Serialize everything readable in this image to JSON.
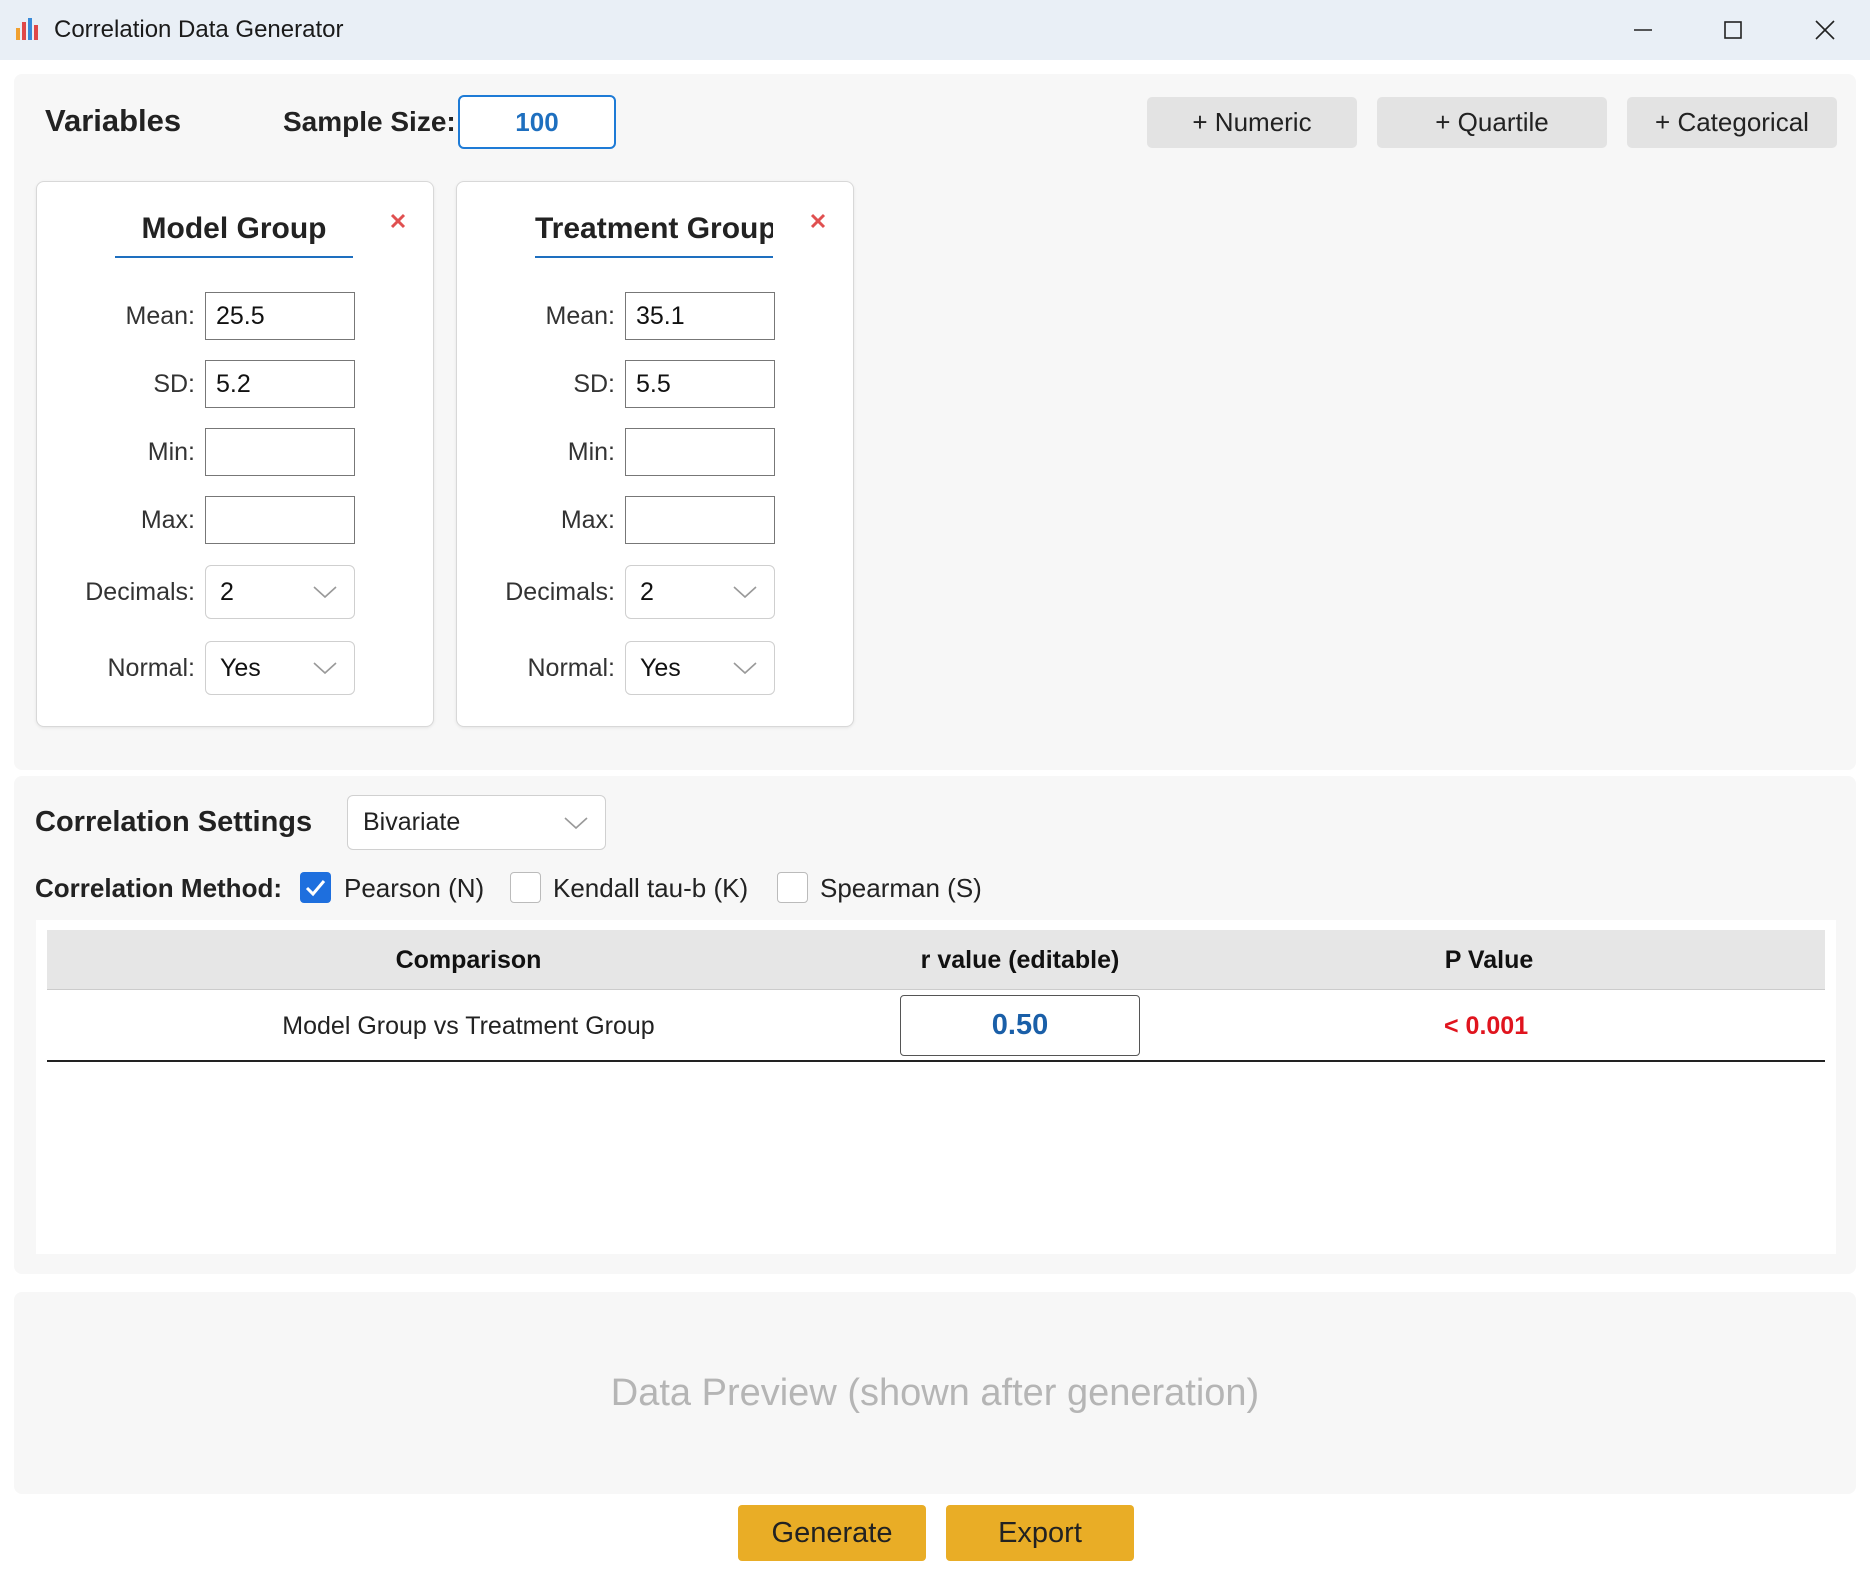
{
  "window": {
    "title": "Correlation Data Generator",
    "app_icon": "bar-chart-icon"
  },
  "variables": {
    "title": "Variables",
    "sample_size_label": "Sample Size:",
    "sample_size_value": "100",
    "add_numeric": "+ Numeric",
    "add_quartile": "+ Quartile",
    "add_categorical": "+ Categorical",
    "cards": [
      {
        "name": "Model Group",
        "mean_label": "Mean:",
        "mean": "25.5",
        "sd_label": "SD:",
        "sd": "5.2",
        "min_label": "Min:",
        "min": "",
        "max_label": "Max:",
        "max": "",
        "decimals_label": "Decimals:",
        "decimals": "2",
        "normal_label": "Normal:",
        "normal": "Yes"
      },
      {
        "name": "Treatment Group",
        "mean_label": "Mean:",
        "mean": "35.1",
        "sd_label": "SD:",
        "sd": "5.5",
        "min_label": "Min:",
        "min": "",
        "max_label": "Max:",
        "max": "",
        "decimals_label": "Decimals:",
        "decimals": "2",
        "normal_label": "Normal:",
        "normal": "Yes"
      }
    ]
  },
  "correlation": {
    "title": "Correlation Settings",
    "type": "Bivariate",
    "method_label": "Correlation Method:",
    "methods": [
      {
        "label": "Pearson (N)",
        "checked": true
      },
      {
        "label": "Kendall tau-b (K)",
        "checked": false
      },
      {
        "label": "Spearman (S)",
        "checked": false
      }
    ],
    "table": {
      "headers": [
        "Comparison",
        "r value (editable)",
        "P Value"
      ],
      "rows": [
        {
          "comparison": "Model Group vs Treatment Group",
          "r": "0.50",
          "p": "< 0.001"
        }
      ]
    }
  },
  "preview": {
    "placeholder": "Data Preview (shown after generation)"
  },
  "actions": {
    "generate": "Generate",
    "export": "Export"
  },
  "colors": {
    "accent": "#1e6fde",
    "primary_button": "#e9ad26",
    "p_value": "#e0141e",
    "close_x": "#e05050"
  }
}
